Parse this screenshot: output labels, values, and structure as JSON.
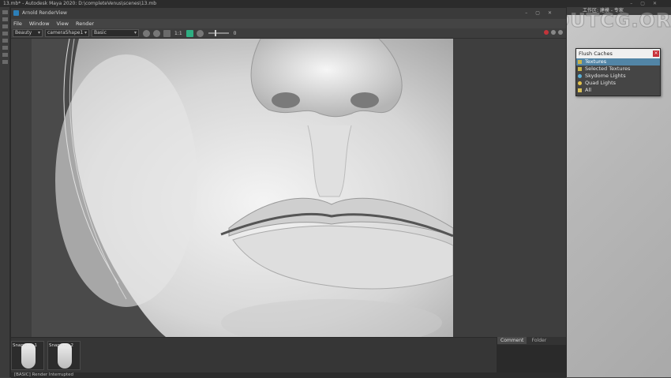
{
  "maya": {
    "title": "13.mb* - Autodesk Maya 2020: D:\\completeVenus\\scenes\\13.mb",
    "right_header": "工作区: 建模 - 专家",
    "watermark": "ABOUTCG.ORG"
  },
  "renderview": {
    "title": "Arnold RenderView",
    "menu": [
      "File",
      "Window",
      "View",
      "Render"
    ],
    "aov_select": "Beauty",
    "camera_select": "cameraShape1",
    "mode_select": "Basic",
    "ratio": "1:1",
    "exposure": "0",
    "snapshots": [
      {
        "label": "Snapshot 1"
      },
      {
        "label": "Snapshot 2"
      }
    ],
    "tabs": [
      "Comment",
      "Folder"
    ],
    "status": "[BASIC] Render Interrupted"
  },
  "flush_caches": {
    "title": "Flush Caches",
    "items": [
      "Textures",
      "Selected Textures",
      "Skydome Lights",
      "Quad Lights",
      "All"
    ],
    "selected": "Textures"
  }
}
